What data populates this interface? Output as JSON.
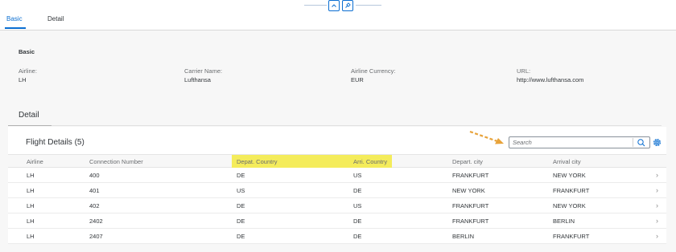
{
  "tabs": [
    {
      "label": "Basic",
      "active": true
    },
    {
      "label": "Detail",
      "active": false
    }
  ],
  "header_buttons": [
    {
      "icon": "collapse-up-icon"
    },
    {
      "icon": "pin-icon"
    }
  ],
  "basic": {
    "title": "Basic",
    "fields": [
      {
        "label": "Airline:",
        "value": "LH"
      },
      {
        "label": "Carrier Name:",
        "value": "Lufthansa"
      },
      {
        "label": "Airline Currency:",
        "value": "EUR"
      },
      {
        "label": "URL:",
        "value": "http://www.lufthansa.com"
      }
    ]
  },
  "detail": {
    "title": "Detail",
    "table": {
      "title": "Flight Details (5)",
      "search_placeholder": "Search",
      "columns": [
        "Airline",
        "Connection Number",
        "Depat. Country",
        "Arri. Country",
        "Depart. city",
        "Arrival city"
      ],
      "highlighted_columns": [
        "Depat. Country",
        "Arri. Country"
      ],
      "highlight_color": "#f4ec5b",
      "rows": [
        [
          "LH",
          "400",
          "DE",
          "US",
          "FRANKFURT",
          "NEW YORK"
        ],
        [
          "LH",
          "401",
          "US",
          "DE",
          "NEW YORK",
          "FRANKFURT"
        ],
        [
          "LH",
          "402",
          "DE",
          "US",
          "FRANKFURT",
          "NEW YORK"
        ],
        [
          "LH",
          "2402",
          "DE",
          "DE",
          "FRANKFURT",
          "BERLIN"
        ],
        [
          "LH",
          "2407",
          "DE",
          "DE",
          "BERLIN",
          "FRANKFURT"
        ]
      ]
    }
  },
  "colors": {
    "accent": "#0a6ed1",
    "annotation_arrow": "#e8a33a"
  }
}
